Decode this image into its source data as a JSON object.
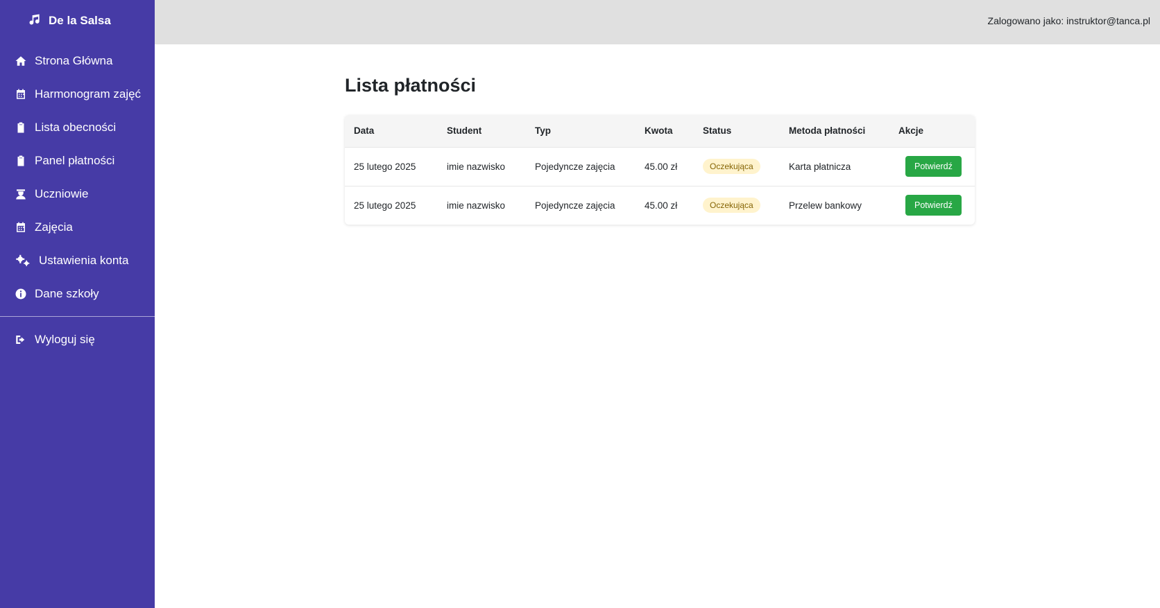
{
  "sidebar": {
    "brand": "De la Salsa",
    "items": [
      {
        "label": "Strona Główna",
        "icon": "home-icon"
      },
      {
        "label": "Harmonogram zajęć",
        "icon": "calendar-icon"
      },
      {
        "label": "Lista obecności",
        "icon": "clipboard-icon"
      },
      {
        "label": "Panel płatności",
        "icon": "clipboard-icon"
      },
      {
        "label": "Uczniowie",
        "icon": "student-icon"
      },
      {
        "label": "Zajęcia",
        "icon": "calendar-icon"
      },
      {
        "label": "Ustawienia konta",
        "icon": "gears-icon"
      },
      {
        "label": "Dane szkoły",
        "icon": "info-icon"
      }
    ],
    "logout": {
      "label": "Wyloguj się",
      "icon": "logout-icon"
    }
  },
  "header": {
    "login_info": "Zalogowano jako: instruktor@tanca.pl"
  },
  "main": {
    "title": "Lista płatności",
    "columns": [
      "Data",
      "Student",
      "Typ",
      "Kwota",
      "Status",
      "Metoda płatności",
      "Akcje"
    ],
    "rows": [
      {
        "date": "25 lutego 2025",
        "student": "imie nazwisko",
        "type": "Pojedyncze zajęcia",
        "amount": "45.00 zł",
        "status": "Oczekująca",
        "method": "Karta płatnicza",
        "action": "Potwierdź"
      },
      {
        "date": "25 lutego 2025",
        "student": "imie nazwisko",
        "type": "Pojedyncze zajęcia",
        "amount": "45.00 zł",
        "status": "Oczekująca",
        "method": "Przelew bankowy",
        "action": "Potwierdź"
      }
    ]
  },
  "colors": {
    "sidebar_bg": "#463ba6",
    "topbar_bg": "#e0e0e0",
    "confirm_button": "#28a745",
    "status_badge_bg": "#fff3cd"
  }
}
